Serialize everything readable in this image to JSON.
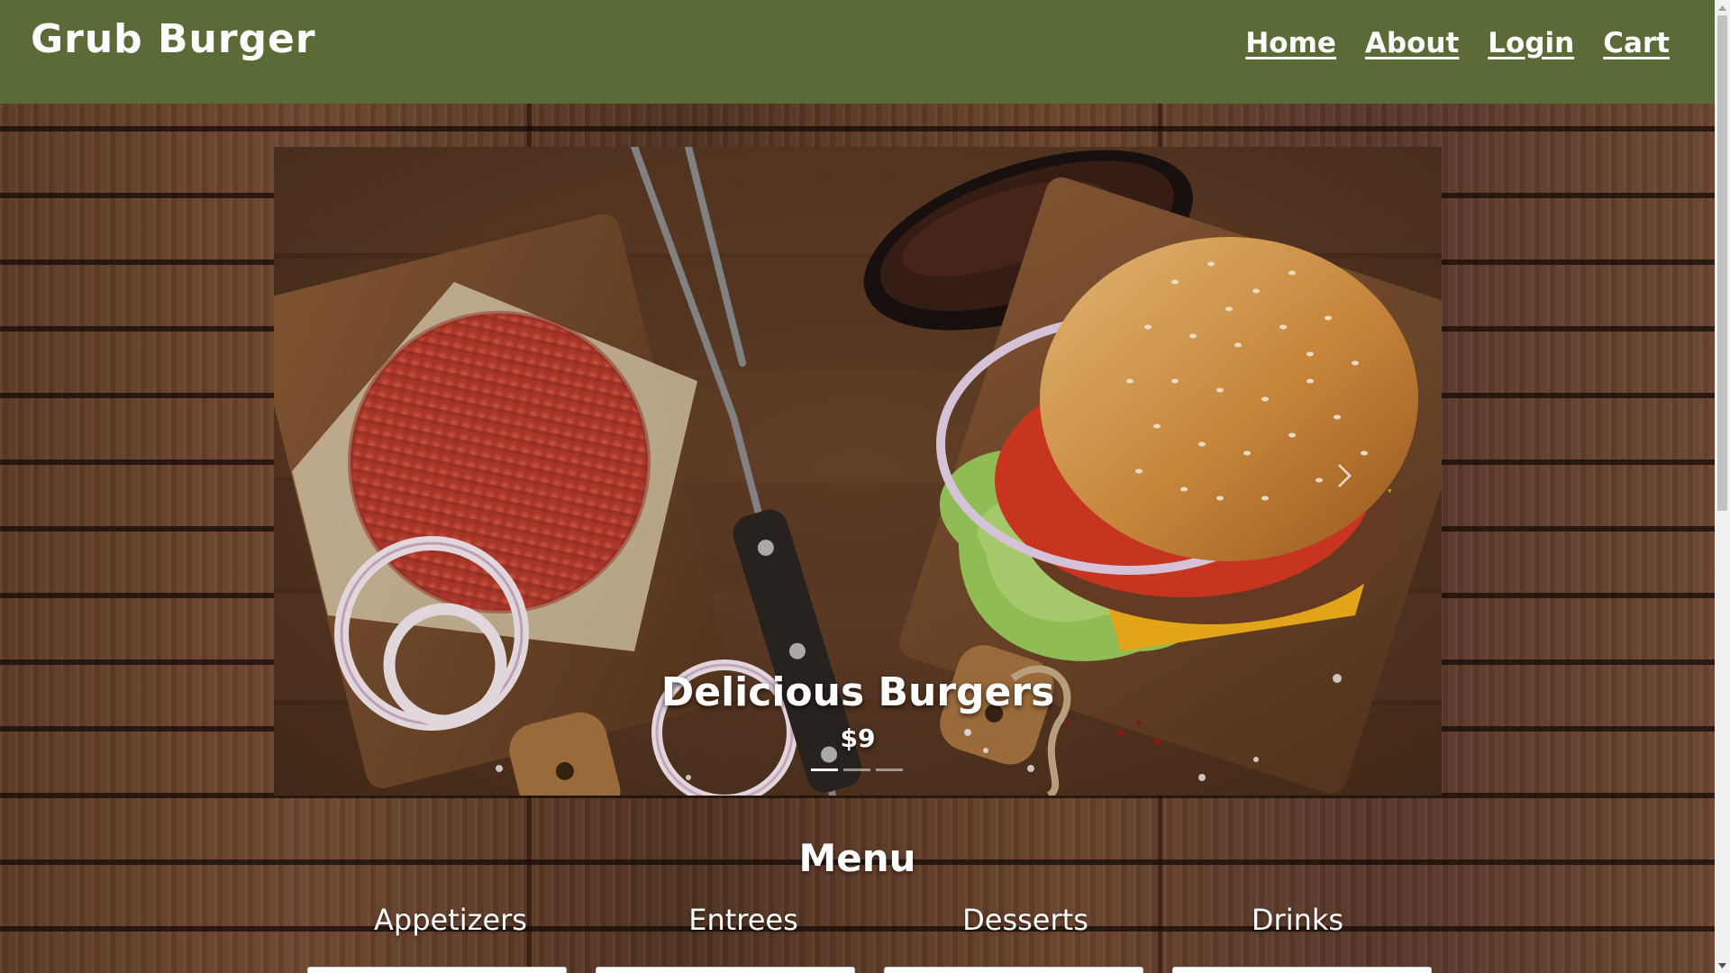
{
  "navbar": {
    "brand": "Grub Burger",
    "links": [
      {
        "label": "Home"
      },
      {
        "label": "About"
      },
      {
        "label": "Login"
      },
      {
        "label": "Cart"
      }
    ],
    "background": "#5b6b37"
  },
  "carousel": {
    "caption_title": "Delicious Burgers",
    "caption_price": "$9",
    "slide_count": 3,
    "active_slide": 2
  },
  "menu": {
    "heading": "Menu",
    "tabs": [
      {
        "label": "Appetizers"
      },
      {
        "label": "Entrees"
      },
      {
        "label": "Desserts"
      },
      {
        "label": "Drinks"
      }
    ]
  },
  "icons": {
    "carousel_next": "chevron-right-icon",
    "carousel_prev": "chevron-left-icon",
    "scroll_up": "scroll-up-arrow-icon",
    "scroll_down": "scroll-down-arrow-icon"
  }
}
